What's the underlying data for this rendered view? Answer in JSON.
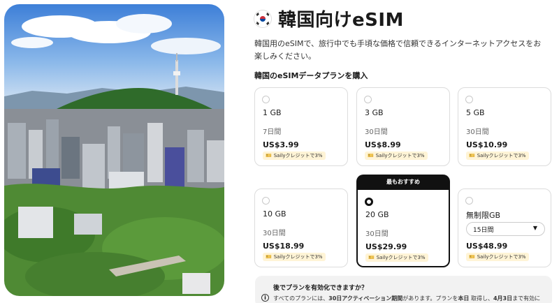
{
  "page": {
    "title": "韓国向けeSIM",
    "description": "韓国用のeSIMで、旅行中でも手頃な価格で信頼できるインターネットアクセスをお楽しみください。",
    "section_heading": "韓国のeSIMデータプランを購入"
  },
  "plans": [
    {
      "gb": "1 GB",
      "days": "7日間",
      "price": "US$3.99",
      "credit": "Sailyクレジットで3%"
    },
    {
      "gb": "3 GB",
      "days": "30日間",
      "price": "US$8.99",
      "credit": "Sailyクレジットで3%"
    },
    {
      "gb": "5 GB",
      "days": "30日間",
      "price": "US$10.99",
      "credit": "Sailyクレジットで3%"
    },
    {
      "gb": "10 GB",
      "days": "30日間",
      "price": "US$18.99",
      "credit": "Sailyクレジットで3%"
    },
    {
      "gb": "20 GB",
      "days": "30日間",
      "price": "US$29.99",
      "credit": "Sailyクレジットで3%",
      "badge": "最もおすすめ",
      "selected": true
    },
    {
      "gb": "無制限GB",
      "days": "15日間",
      "price": "US$48.99",
      "credit": "Sailyクレジットで3%",
      "dropdown": true
    }
  ],
  "faq": {
    "question": "後でプランを有効化できますか？",
    "answer_pre": "すべてのプランには、",
    "answer_bold1": "30日アクティベーション期間",
    "answer_mid": "があります。プランを",
    "answer_bold2": "本日",
    "answer_mid2": " 取得し、",
    "answer_bold3": "4月3日",
    "answer_post": "まで有効に",
    "info_icon": "i"
  },
  "icons": {
    "flag": "korea-flag-icon",
    "credit": "ticket-icon",
    "dropdown": "chevron-down-icon"
  },
  "colors": {
    "accent": "#111111",
    "credit_bg": "#fff4d6",
    "faq_bg": "#f2f2f2"
  }
}
